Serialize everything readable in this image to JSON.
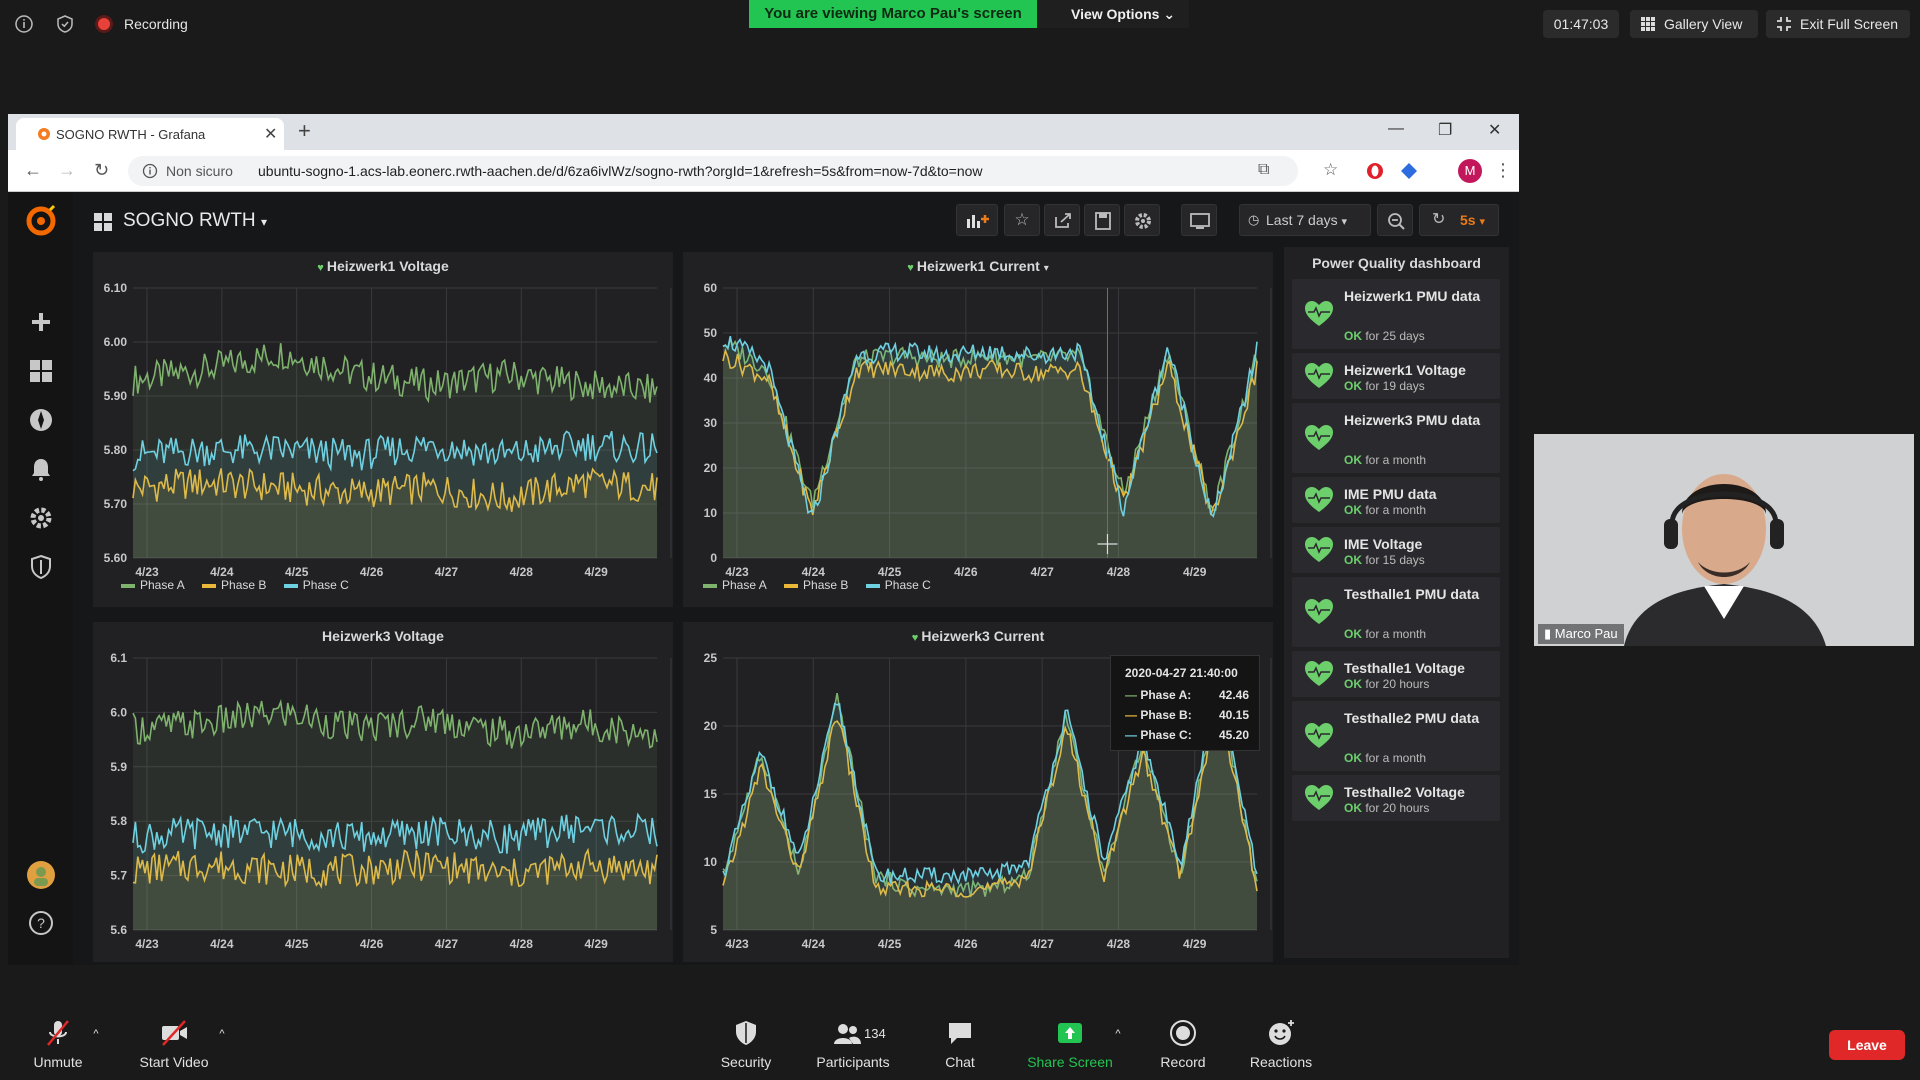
{
  "zoom_top": {
    "recording_label": "Recording",
    "viewing_banner": "You are viewing Marco Pau's screen",
    "view_options": "View Options",
    "timer": "01:47:03",
    "gallery_view": "Gallery View",
    "exit_full_screen": "Exit Full Screen"
  },
  "browser": {
    "tab_title": "SOGNO RWTH - Grafana",
    "not_secure": "Non sicuro",
    "url": "ubuntu-sogno-1.acs-lab.eonerc.rwth-aachen.de/d/6za6ivlWz/sogno-rwth?orgId=1&refresh=5s&from=now-7d&to=now",
    "profile_letter": "M"
  },
  "grafana": {
    "dashboard_title": "SOGNO RWTH",
    "time_range": "Last 7 days",
    "refresh_interval": "5s",
    "panels": {
      "hw1_voltage": {
        "title": "Heizwerk1 Voltage"
      },
      "hw1_current": {
        "title": "Heizwerk1 Current"
      },
      "hw3_voltage": {
        "title": "Heizwerk3 Voltage"
      },
      "hw3_current": {
        "title": "Heizwerk3 Current"
      }
    },
    "legend": [
      "Phase A",
      "Phase B",
      "Phase C"
    ],
    "tooltip": {
      "time": "2020-04-27 21:40:00",
      "rows": [
        {
          "label": "Phase A:",
          "value": "42.46"
        },
        {
          "label": "Phase B:",
          "value": "40.15"
        },
        {
          "label": "Phase C:",
          "value": "45.20"
        }
      ]
    },
    "power_quality": {
      "title": "Power Quality dashboard",
      "items": [
        {
          "name": "Heizwerk1 PMU data",
          "ok": "OK",
          "duration": "for 25 days"
        },
        {
          "name": "Heizwerk1 Voltage",
          "ok": "OK",
          "duration": "for 19 days"
        },
        {
          "name": "Heizwerk3 PMU data",
          "ok": "OK",
          "duration": "for a month"
        },
        {
          "name": "IME PMU data",
          "ok": "OK",
          "duration": "for a month"
        },
        {
          "name": "IME Voltage",
          "ok": "OK",
          "duration": "for 15 days"
        },
        {
          "name": "Testhalle1 PMU data",
          "ok": "OK",
          "duration": "for a month"
        },
        {
          "name": "Testhalle1 Voltage",
          "ok": "OK",
          "duration": "for 20 hours"
        },
        {
          "name": "Testhalle2 PMU data",
          "ok": "OK",
          "duration": "for a month"
        },
        {
          "name": "Testhalle2 Voltage",
          "ok": "OK",
          "duration": "for 20 hours"
        }
      ]
    }
  },
  "webcam": {
    "name": "Marco Pau"
  },
  "zoom_bottom": {
    "unmute": "Unmute",
    "start_video": "Start Video",
    "security": "Security",
    "participants": "Participants",
    "participant_count": "134",
    "chat": "Chat",
    "share_screen": "Share Screen",
    "record": "Record",
    "reactions": "Reactions",
    "leave": "Leave"
  },
  "colors": {
    "phase_a": "#7eb26d",
    "phase_b": "#eab839",
    "phase_c": "#6ed0e0",
    "grafana_bg": "#161719",
    "panel_bg": "#212124",
    "zoom_green": "#23c552",
    "leave_red": "#e02828"
  },
  "chart_data": [
    {
      "type": "line",
      "title": "Heizwerk1 Voltage",
      "x": [
        "4/23",
        "4/24",
        "4/25",
        "4/26",
        "4/27",
        "4/28",
        "4/29"
      ],
      "yticks": [
        "5.60",
        "5.70",
        "5.80",
        "5.90",
        "6.00",
        "6.10"
      ],
      "ylim": [
        5.6,
        6.1
      ],
      "series": [
        {
          "name": "Phase A",
          "values": [
            5.93,
            5.95,
            5.98,
            5.94,
            5.92,
            5.94,
            5.92,
            5.91
          ]
        },
        {
          "name": "Phase B",
          "values": [
            5.73,
            5.74,
            5.73,
            5.72,
            5.73,
            5.71,
            5.74,
            5.73
          ]
        },
        {
          "name": "Phase C",
          "values": [
            5.79,
            5.8,
            5.8,
            5.79,
            5.81,
            5.79,
            5.81,
            5.8
          ]
        }
      ],
      "grid": true,
      "legend": "bottom"
    },
    {
      "type": "line",
      "title": "Heizwerk1 Current",
      "x": [
        "4/23",
        "4/24",
        "4/25",
        "4/26",
        "4/27",
        "4/28",
        "4/29"
      ],
      "yticks": [
        "0",
        "10",
        "20",
        "30",
        "40",
        "50",
        "60"
      ],
      "ylim": [
        0,
        60
      ],
      "series": [
        {
          "name": "Phase A",
          "values": [
            48,
            42,
            12,
            44,
            45,
            44,
            45,
            44,
            45,
            14,
            46,
            10,
            45
          ]
        },
        {
          "name": "Phase B",
          "values": [
            45,
            40,
            10,
            42,
            42,
            41,
            42,
            41,
            42,
            12,
            43,
            9,
            42
          ]
        },
        {
          "name": "Phase C",
          "values": [
            49,
            43,
            8,
            45,
            46,
            45,
            46,
            45,
            46,
            11,
            47,
            8,
            46
          ]
        }
      ],
      "grid": true,
      "legend": "bottom"
    },
    {
      "type": "line",
      "title": "Heizwerk3 Voltage",
      "x": [
        "4/23",
        "4/24",
        "4/25",
        "4/26",
        "4/27",
        "4/28",
        "4/29"
      ],
      "yticks": [
        "5.6",
        "5.7",
        "5.8",
        "5.9",
        "6.0",
        "6.1"
      ],
      "ylim": [
        5.6,
        6.1
      ],
      "series": [
        {
          "name": "Phase A",
          "values": [
            5.97,
            5.98,
            6.0,
            5.97,
            5.99,
            5.96,
            5.98,
            5.96
          ]
        },
        {
          "name": "Phase B",
          "values": [
            5.71,
            5.72,
            5.71,
            5.71,
            5.72,
            5.7,
            5.72,
            5.71
          ]
        },
        {
          "name": "Phase C",
          "values": [
            5.77,
            5.78,
            5.78,
            5.77,
            5.78,
            5.77,
            5.79,
            5.78
          ]
        }
      ],
      "grid": true
    },
    {
      "type": "line",
      "title": "Heizwerk3 Current",
      "x": [
        "4/23",
        "4/24",
        "4/25",
        "4/26",
        "4/27",
        "4/28",
        "4/29"
      ],
      "yticks": [
        "5",
        "10",
        "15",
        "20",
        "25"
      ],
      "ylim": [
        5,
        25
      ],
      "series": [
        {
          "name": "Phase A",
          "values": [
            9,
            18,
            9,
            22,
            9,
            8,
            8,
            8,
            9,
            21,
            9,
            19,
            9,
            23,
            8
          ]
        },
        {
          "name": "Phase B",
          "values": [
            8,
            17,
            9,
            21,
            8,
            8,
            8,
            8,
            9,
            20,
            9,
            18,
            9,
            22,
            8
          ]
        },
        {
          "name": "Phase C",
          "values": [
            9,
            18,
            10,
            22,
            9,
            9,
            9,
            9,
            10,
            21,
            10,
            19,
            10,
            23,
            9
          ]
        }
      ],
      "grid": true
    }
  ]
}
